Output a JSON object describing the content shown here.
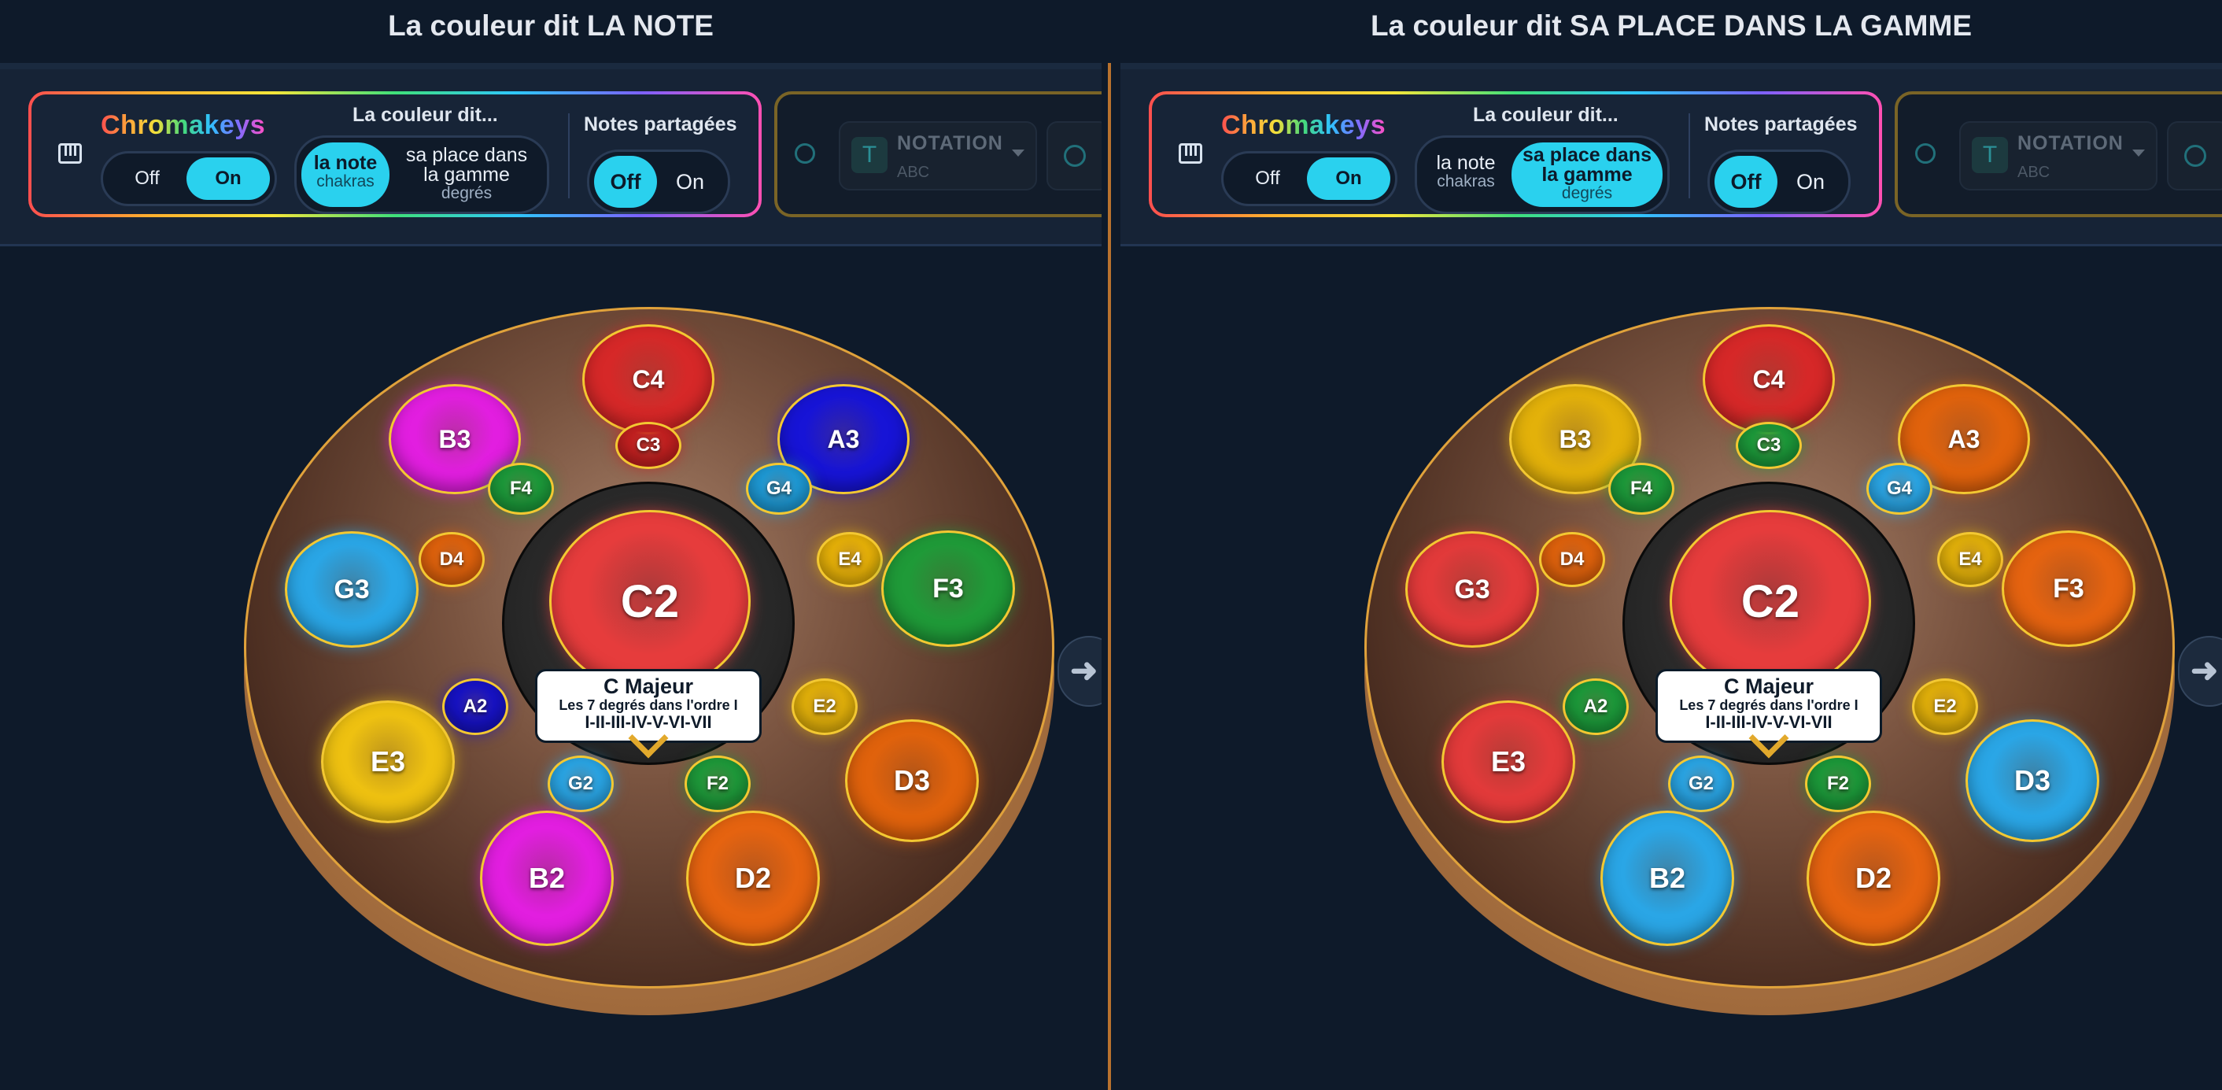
{
  "panels": [
    {
      "title": "La couleur dit LA NOTE",
      "chromakeys": {
        "brand": "Chromakeys",
        "off": "Off",
        "on": "On",
        "active": "on"
      },
      "couleur_dit": {
        "label": "La couleur dit...",
        "opt1_main": "la note",
        "opt1_sub": "chakras",
        "opt2_main": "sa place dans la gamme",
        "opt2_sub": "degrés",
        "active": "opt1"
      },
      "notes_partagees": {
        "label": "Notes partagées",
        "off": "Off",
        "on": "On",
        "active": "off"
      },
      "notation": {
        "label": "NOTATION",
        "value": "ABC",
        "t_glyph": "T"
      },
      "drum": {
        "info_title": "C Majeur",
        "info_sub": "Les 7 degrés dans l'ordre I",
        "info_degrees": "I-II-III-IV-V-VI-VII",
        "notes": [
          {
            "label": "C4",
            "color": "#d62828"
          },
          {
            "label": "C3",
            "color": "#c42020"
          },
          {
            "label": "B3",
            "color": "#e21ee0"
          },
          {
            "label": "A3",
            "color": "#1714d6"
          },
          {
            "label": "F4",
            "color": "#1c9a3a"
          },
          {
            "label": "G4",
            "color": "#1e9ad6"
          },
          {
            "label": "G3",
            "color": "#2aa6e6"
          },
          {
            "label": "D4",
            "color": "#e0620c"
          },
          {
            "label": "E4",
            "color": "#e8b208"
          },
          {
            "label": "F3",
            "color": "#1f9a38"
          },
          {
            "label": "C2",
            "color": "#e63c3c"
          },
          {
            "label": "A2",
            "color": "#1712c6"
          },
          {
            "label": "E2",
            "color": "#e3b10a"
          },
          {
            "label": "E3",
            "color": "#eec111"
          },
          {
            "label": "D3",
            "color": "#e0620c"
          },
          {
            "label": "G2",
            "color": "#2aa6e6"
          },
          {
            "label": "F2",
            "color": "#1e9a3a"
          },
          {
            "label": "B2",
            "color": "#e21ee0"
          },
          {
            "label": "D2",
            "color": "#e56310"
          }
        ]
      }
    },
    {
      "title": "La couleur dit SA PLACE DANS LA GAMME",
      "chromakeys": {
        "brand": "Chromakeys",
        "off": "Off",
        "on": "On",
        "active": "on"
      },
      "couleur_dit": {
        "label": "La couleur dit...",
        "opt1_main": "la note",
        "opt1_sub": "chakras",
        "opt2_main": "sa place dans la gamme",
        "opt2_sub": "degrés",
        "active": "opt2"
      },
      "notes_partagees": {
        "label": "Notes partagées",
        "off": "Off",
        "on": "On",
        "active": "off"
      },
      "notation": {
        "label": "NOTATION",
        "value": "ABC",
        "t_glyph": "T"
      },
      "drum": {
        "info_title": "C Majeur",
        "info_sub": "Les 7 degrés dans l'ordre I",
        "info_degrees": "I-II-III-IV-V-VI-VII",
        "notes": [
          {
            "label": "C4",
            "color": "#d62828"
          },
          {
            "label": "C3",
            "color": "#1c9a3a"
          },
          {
            "label": "B3",
            "color": "#e3b10a"
          },
          {
            "label": "A3",
            "color": "#e0620c"
          },
          {
            "label": "F4",
            "color": "#1c9a3a"
          },
          {
            "label": "G4",
            "color": "#2aa6e6"
          },
          {
            "label": "G3",
            "color": "#e23a3a"
          },
          {
            "label": "D4",
            "color": "#e0620c"
          },
          {
            "label": "E4",
            "color": "#e3b10a"
          },
          {
            "label": "F3",
            "color": "#e56310"
          },
          {
            "label": "C2",
            "color": "#e63c3c"
          },
          {
            "label": "A2",
            "color": "#1c9a3a"
          },
          {
            "label": "E2",
            "color": "#e3b10a"
          },
          {
            "label": "E3",
            "color": "#e23a3a"
          },
          {
            "label": "D3",
            "color": "#2aa6e6"
          },
          {
            "label": "G2",
            "color": "#2aa6e6"
          },
          {
            "label": "F2",
            "color": "#1c9a3a"
          },
          {
            "label": "B2",
            "color": "#2aa6e6"
          },
          {
            "label": "D2",
            "color": "#e56310"
          }
        ]
      }
    }
  ],
  "icons": {
    "piano": "piano-icon",
    "notation_settings": "palette-icon",
    "collapse": "arrow-left-icon"
  }
}
